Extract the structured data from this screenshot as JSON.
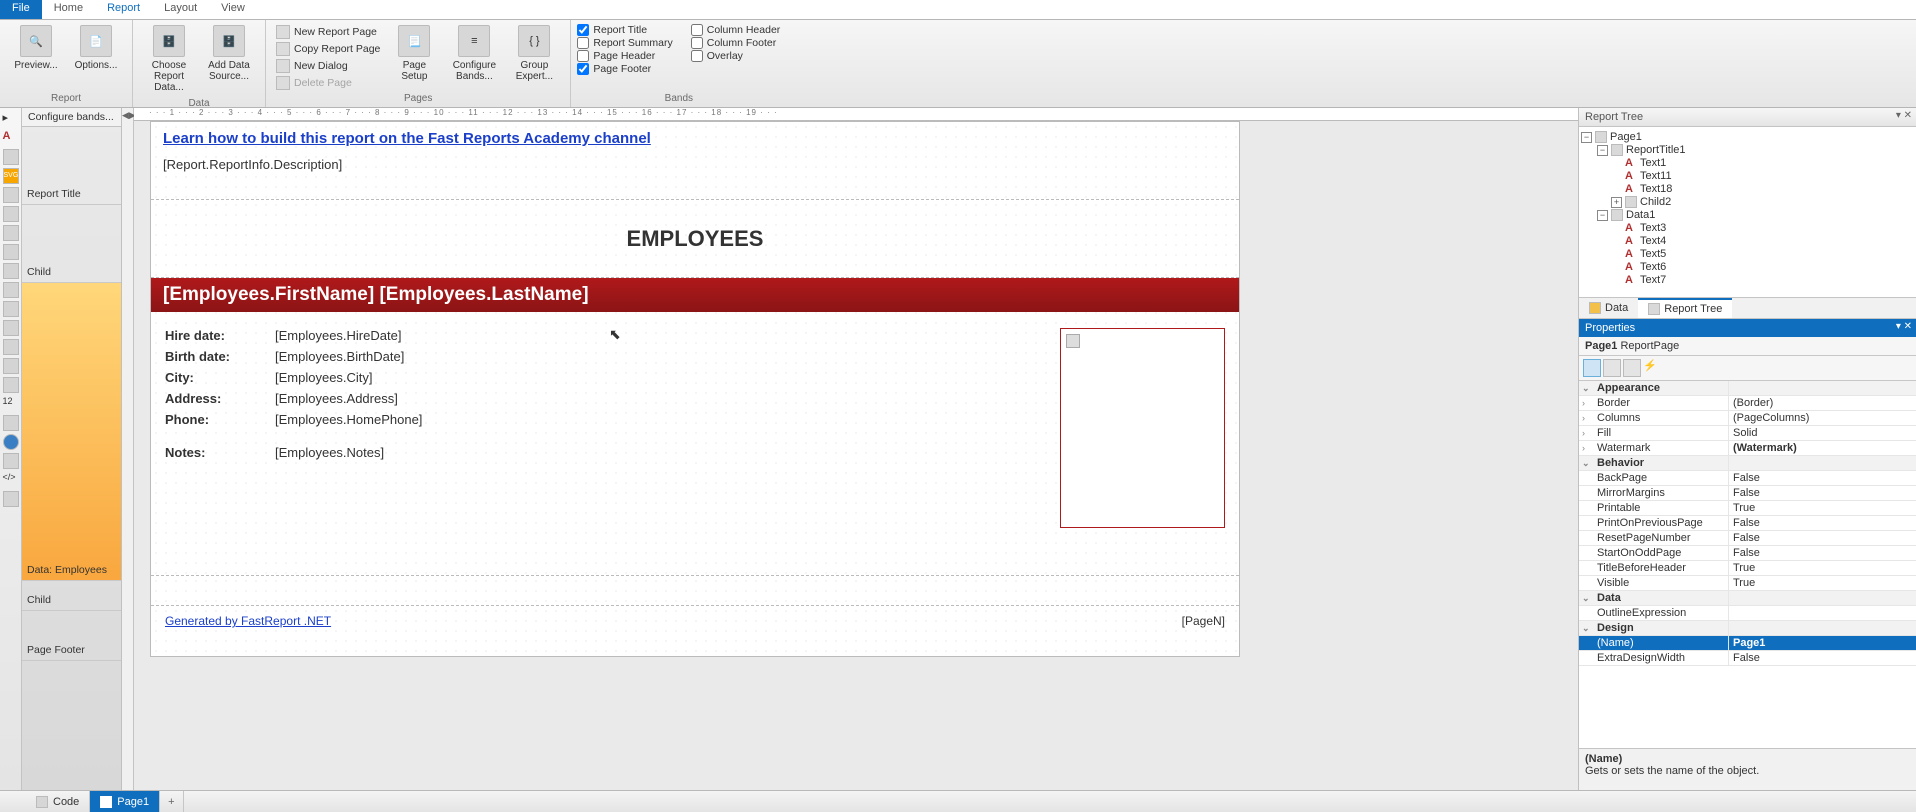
{
  "tabs": {
    "file": "File",
    "home": "Home",
    "report": "Report",
    "layout": "Layout",
    "view": "View"
  },
  "ribbon": {
    "report": {
      "label": "Report",
      "preview": "Preview...",
      "options": "Options..."
    },
    "data": {
      "label": "Data",
      "choose": "Choose Report\nData...",
      "addsource": "Add Data\nSource..."
    },
    "pages": {
      "label": "Pages",
      "newpage": "New Report Page",
      "copypage": "Copy Report Page",
      "newdialog": "New Dialog",
      "deletepage": "Delete Page",
      "pagesetup": "Page\nSetup",
      "configurebands": "Configure\nBands...",
      "groupexpert": "Group\nExpert..."
    },
    "bands": {
      "label": "Bands",
      "reporttitle": "Report Title",
      "reportsummary": "Report Summary",
      "pageheader": "Page Header",
      "pagefooter": "Page Footer",
      "columnheader": "Column Header",
      "columnfooter": "Column Footer",
      "overlay": "Overlay"
    }
  },
  "bandcol": {
    "header": "Configure bands...",
    "title": "Report Title",
    "child1": "Child",
    "data": "Data: Employees",
    "child2": "Child",
    "footer": "Page Footer"
  },
  "design": {
    "learn": "Learn how to build this report on the Fast Reports Academy channel",
    "desc": "[Report.ReportInfo.Description]",
    "heading": "EMPLOYEES",
    "name_expr": "[Employees.FirstName] [Employees.LastName]",
    "rows": {
      "hire_l": "Hire date:",
      "hire_v": "[Employees.HireDate]",
      "birth_l": "Birth date:",
      "birth_v": "[Employees.BirthDate]",
      "city_l": "City:",
      "city_v": "[Employees.City]",
      "addr_l": "Address:",
      "addr_v": "[Employees.Address]",
      "phone_l": "Phone:",
      "phone_v": "[Employees.HomePhone]",
      "notes_l": "Notes:",
      "notes_v": "[Employees.Notes]"
    },
    "gen": "Generated by FastReport .NET",
    "pagen": "[PageN]"
  },
  "tree_panel": {
    "title": "Report Tree",
    "page": "Page1",
    "rt": "ReportTitle1",
    "t1": "Text1",
    "t11": "Text11",
    "t18": "Text18",
    "c2": "Child2",
    "d1": "Data1",
    "t3": "Text3",
    "t4": "Text4",
    "t5": "Text5",
    "t6": "Text6",
    "t7": "Text7",
    "tab_data": "Data",
    "tab_tree": "Report Tree"
  },
  "props": {
    "title": "Properties",
    "head_name": "Page1",
    "head_type": "ReportPage",
    "cats": {
      "appearance": "Appearance",
      "behavior": "Behavior",
      "data": "Data",
      "design": "Design"
    },
    "rows": {
      "border_l": "Border",
      "border_v": "(Border)",
      "columns_l": "Columns",
      "columns_v": "(PageColumns)",
      "fill_l": "Fill",
      "fill_v": "Solid",
      "watermark_l": "Watermark",
      "watermark_v": "(Watermark)",
      "backpage_l": "BackPage",
      "backpage_v": "False",
      "mirror_l": "MirrorMargins",
      "mirror_v": "False",
      "printable_l": "Printable",
      "printable_v": "True",
      "printprev_l": "PrintOnPreviousPage",
      "printprev_v": "False",
      "resetpn_l": "ResetPageNumber",
      "resetpn_v": "False",
      "startodd_l": "StartOnOddPage",
      "startodd_v": "False",
      "titlebefore_l": "TitleBeforeHeader",
      "titlebefore_v": "True",
      "visible_l": "Visible",
      "visible_v": "True",
      "outline_l": "OutlineExpression",
      "outline_v": "",
      "name_l": "(Name)",
      "name_v": "Page1",
      "extradw_l": "ExtraDesignWidth",
      "extradw_v": "False"
    },
    "help_t": "(Name)",
    "help_d": "Gets or sets the name of the object."
  },
  "doctabs": {
    "code": "Code",
    "page1": "Page1"
  }
}
